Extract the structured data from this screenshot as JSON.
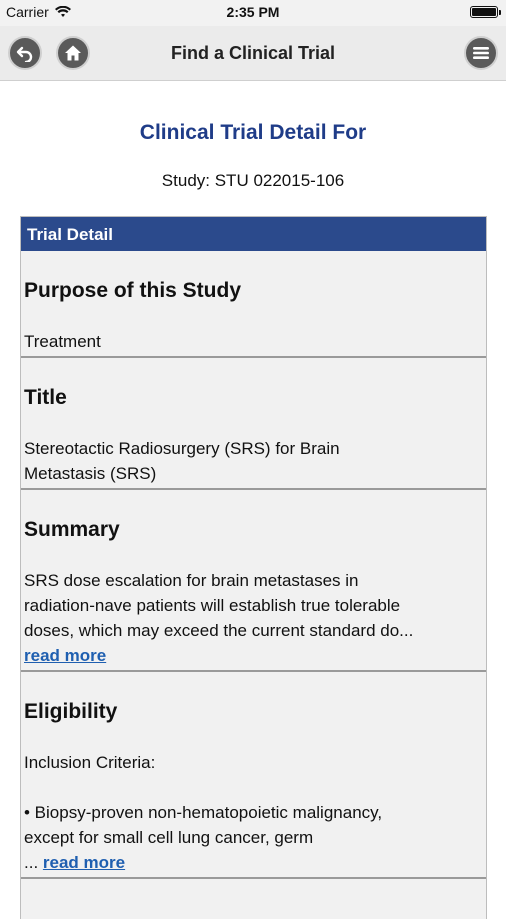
{
  "status": {
    "carrier": "Carrier",
    "time": "2:35 PM"
  },
  "nav": {
    "title": "Find a Clinical Trial"
  },
  "heading": "Clinical Trial Detail For",
  "study_line": "Study: STU 022015-106",
  "panel": {
    "header": "Trial Detail",
    "sections": [
      {
        "title": "Purpose of this Study",
        "lines": [
          "Treatment"
        ]
      },
      {
        "title": "Title",
        "lines": [
          "Stereotactic Radiosurgery (SRS) for Brain",
          "Metastasis (SRS)"
        ]
      },
      {
        "title": "Summary",
        "lines": [
          "SRS dose escalation for brain metastases in",
          "radiation-nave patients will establish true tolerable",
          "doses, which may exceed the current standard do..."
        ],
        "read_more": "read more"
      },
      {
        "title": "Eligibility",
        "lines": [
          "Inclusion Criteria:",
          "",
          "• Biopsy-proven non-hematopoietic malignancy,",
          "except for small cell lung cancer, germ"
        ],
        "read_more_prefix": "... ",
        "read_more": "read more"
      }
    ]
  },
  "colors": {
    "heading": "#1f3c88",
    "panel_header": "#2b4a8c",
    "link": "#1f5fb0"
  }
}
